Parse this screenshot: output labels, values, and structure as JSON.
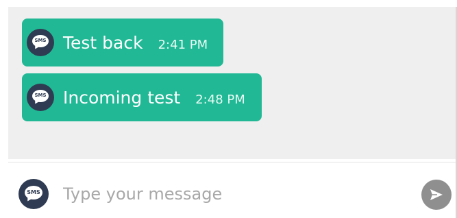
{
  "messages": [
    {
      "text": "Test back",
      "time": "2:41 PM",
      "icon": "sms-icon",
      "icon_label": "SMS"
    },
    {
      "text": "Incoming test",
      "time": "2:48 PM",
      "icon": "sms-icon",
      "icon_label": "SMS"
    }
  ],
  "composer": {
    "channel_icon": "sms-icon",
    "channel_icon_label": "SMS",
    "placeholder": "Type your message",
    "value": "",
    "send_icon": "send-icon"
  },
  "colors": {
    "bubble": "#21b895",
    "icon_dark": "#2f3b52",
    "thread_bg": "#efefef",
    "send_button": "#8f8f8f"
  }
}
